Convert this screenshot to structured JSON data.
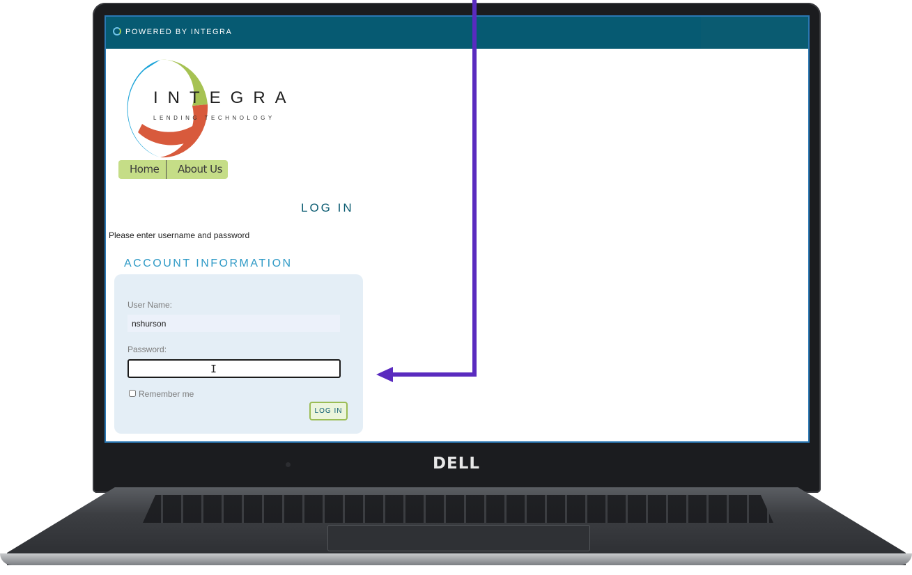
{
  "topbar": {
    "powered_text": "POWERED BY INTEGRA"
  },
  "logo": {
    "name": "INTEGRA",
    "tagline": "LENDING TECHNOLOGY"
  },
  "nav": {
    "items": [
      {
        "label": "Home"
      },
      {
        "label": "About Us"
      }
    ]
  },
  "page": {
    "title": "LOG IN",
    "instruction": "Please enter username and password",
    "section_title": "ACCOUNT INFORMATION"
  },
  "form": {
    "username_label": "User Name:",
    "username_value": "nshurson",
    "password_label": "Password:",
    "password_value": "",
    "remember_label": "Remember me",
    "remember_checked": false,
    "login_button": "LOG IN"
  },
  "device": {
    "brand": "DELL"
  },
  "colors": {
    "topbar": "#065a72",
    "accent_blue": "#2f9ac6",
    "nav_green": "#c5dd87",
    "annotation_arrow": "#5a2bbf"
  }
}
